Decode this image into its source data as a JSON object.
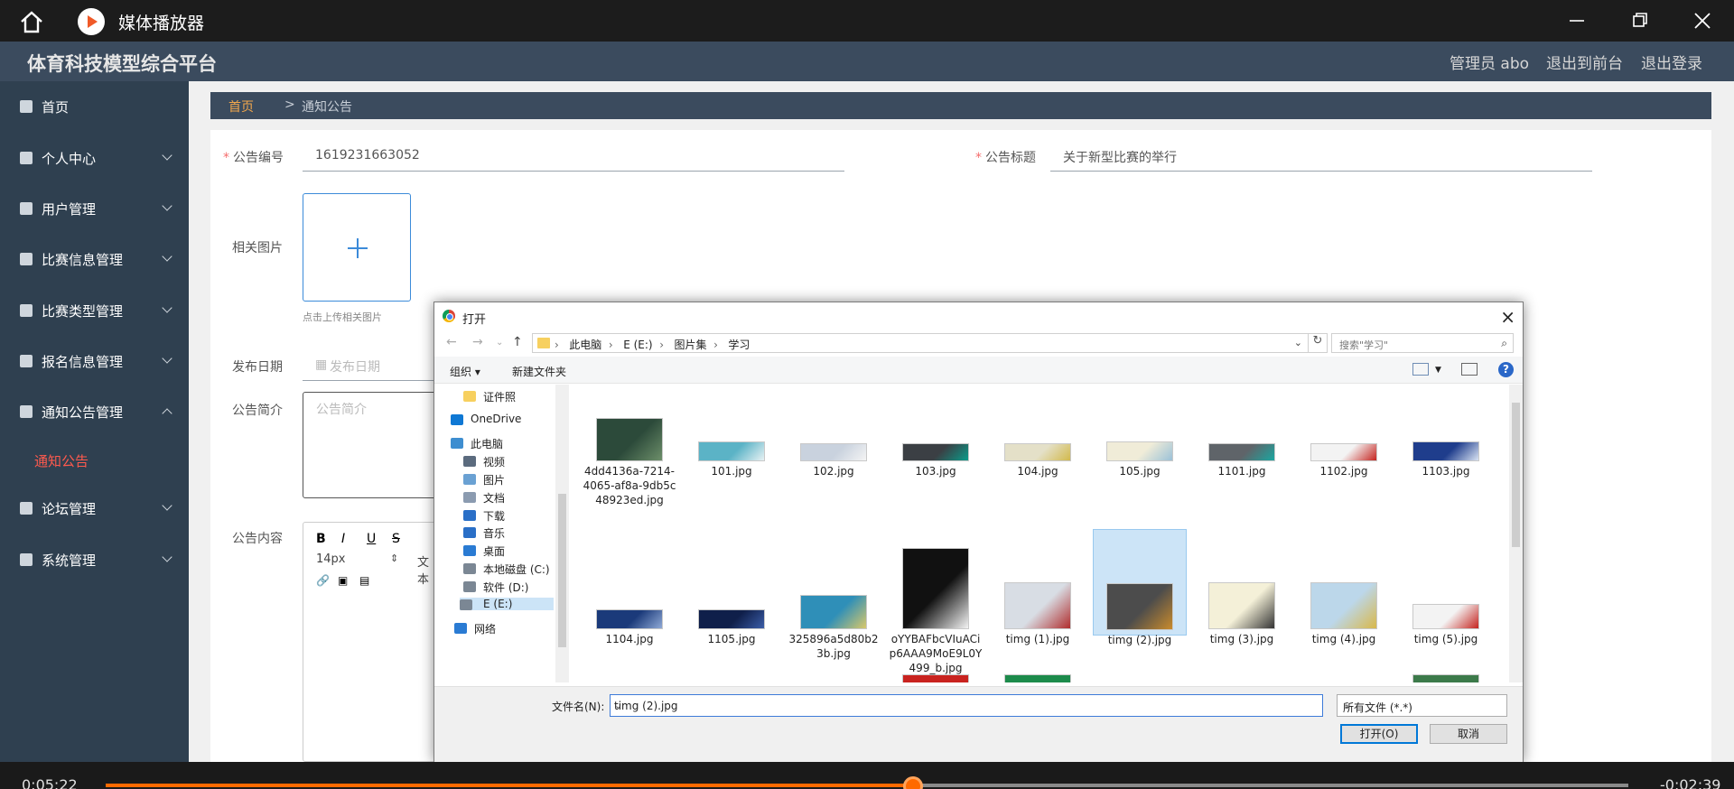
{
  "player": {
    "title": "媒体播放器",
    "elapsed": "0:05:22",
    "remaining": "-0:02:39",
    "progress": 0.53
  },
  "app": {
    "title": "体育科技模型综合平台",
    "header_links": [
      "管理员 abo",
      "退出到前台",
      "退出登录"
    ]
  },
  "sidebar": {
    "items": [
      {
        "label": "首页",
        "icon": "home-icon"
      },
      {
        "label": "个人中心",
        "icon": "user-icon"
      },
      {
        "label": "用户管理",
        "icon": "chart-icon"
      },
      {
        "label": "比赛信息管理",
        "icon": "monitor-icon"
      },
      {
        "label": "比赛类型管理",
        "icon": "crop-icon"
      },
      {
        "label": "报名信息管理",
        "icon": "pin-icon"
      },
      {
        "label": "通知公告管理",
        "icon": "phone-icon"
      },
      {
        "label": "论坛管理",
        "icon": "list-icon"
      },
      {
        "label": "系统管理",
        "icon": "compass-icon"
      }
    ],
    "active_sub": "通知公告"
  },
  "breadcrumb": {
    "home": "首页",
    "sep": ">",
    "current": "通知公告"
  },
  "form": {
    "notice_no_label": "公告编号",
    "notice_no_value": "1619231663052",
    "notice_title_label": "公告标题",
    "notice_title_value": "关于新型比赛的举行",
    "image_label": "相关图片",
    "upload_hint": "点击上传相关图片",
    "date_label": "发布日期",
    "date_placeholder": "发布日期",
    "summary_label": "公告简介",
    "summary_placeholder": "公告简介",
    "content_label": "公告内容",
    "editor_font_size": "14px",
    "editor_text_style": "文本"
  },
  "dialog": {
    "title": "打开",
    "path": [
      "此电脑",
      "E (E:)",
      "图片集",
      "学习"
    ],
    "search_placeholder": "搜索\"学习\"",
    "toolbar": {
      "organize": "组织",
      "new_folder": "新建文件夹"
    },
    "nav_items": [
      {
        "label": "证件照",
        "icon": "folder-icon"
      },
      {
        "label": "OneDrive",
        "icon": "cloud-icon"
      },
      {
        "label": "此电脑",
        "icon": "computer-icon"
      },
      {
        "label": "视频",
        "icon": "video-icon"
      },
      {
        "label": "图片",
        "icon": "picture-icon"
      },
      {
        "label": "文档",
        "icon": "document-icon"
      },
      {
        "label": "下载",
        "icon": "download-icon"
      },
      {
        "label": "音乐",
        "icon": "music-icon"
      },
      {
        "label": "桌面",
        "icon": "desktop-icon"
      },
      {
        "label": "本地磁盘 (C:)",
        "icon": "drive-icon"
      },
      {
        "label": "软件 (D:)",
        "icon": "drive-icon"
      },
      {
        "label": "E (E:)",
        "icon": "drive-icon"
      },
      {
        "label": "网络",
        "icon": "network-icon"
      }
    ],
    "files_row1": [
      "4dd4136a-7214-4065-af8a-9db5c48923ed.jpg",
      "101.jpg",
      "102.jpg",
      "103.jpg",
      "104.jpg",
      "105.jpg",
      "1101.jpg",
      "1102.jpg",
      "1103.jpg"
    ],
    "files_row2": [
      "1104.jpg",
      "1105.jpg",
      "325896a5d80b23b.jpg",
      "oYYBAFbcVIuACip6AAA9MoE9L0Y499_b.jpg",
      "timg (1).jpg",
      "timg (2).jpg",
      "timg (3).jpg",
      "timg (4).jpg",
      "timg (5).jpg"
    ],
    "selected_file": "timg (2).jpg",
    "filename_label": "文件名(N):",
    "filename_value": "timg (2).jpg",
    "filetype_value": "所有文件 (*.*)",
    "open_button": "打开(O)",
    "cancel_button": "取消"
  }
}
